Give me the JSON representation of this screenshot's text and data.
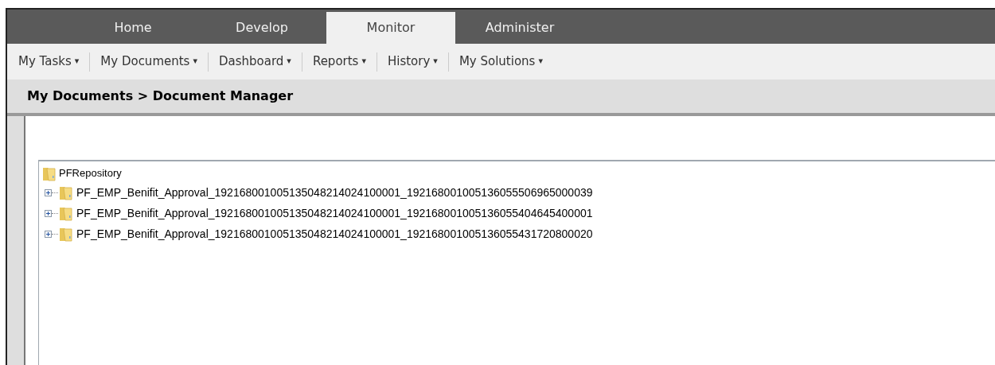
{
  "tabs": [
    {
      "label": "Home",
      "selected": false
    },
    {
      "label": "Develop",
      "selected": false
    },
    {
      "label": "Monitor",
      "selected": true
    },
    {
      "label": "Administer",
      "selected": false
    }
  ],
  "menu": [
    {
      "label": "My Tasks",
      "caret": "▾"
    },
    {
      "label": "My Documents",
      "caret": "▾"
    },
    {
      "label": "Dashboard",
      "caret": "▾"
    },
    {
      "label": "Reports",
      "caret": "▾"
    },
    {
      "label": "History",
      "caret": "▾"
    },
    {
      "label": "My Solutions",
      "caret": "▾"
    }
  ],
  "breadcrumb": "My Documents > Document Manager",
  "tree": {
    "label": "PFRepository",
    "children": [
      {
        "label": "PF_EMP_Benifit_Approval_192168001005135048214024100001_192168001005136055506965000039",
        "expanded": false
      },
      {
        "label": "PF_EMP_Benifit_Approval_192168001005135048214024100001_192168001005136055404645400001",
        "expanded": false
      },
      {
        "label": "PF_EMP_Benifit_Approval_192168001005135048214024100001_192168001005136055431720800020",
        "expanded": false
      }
    ]
  }
}
